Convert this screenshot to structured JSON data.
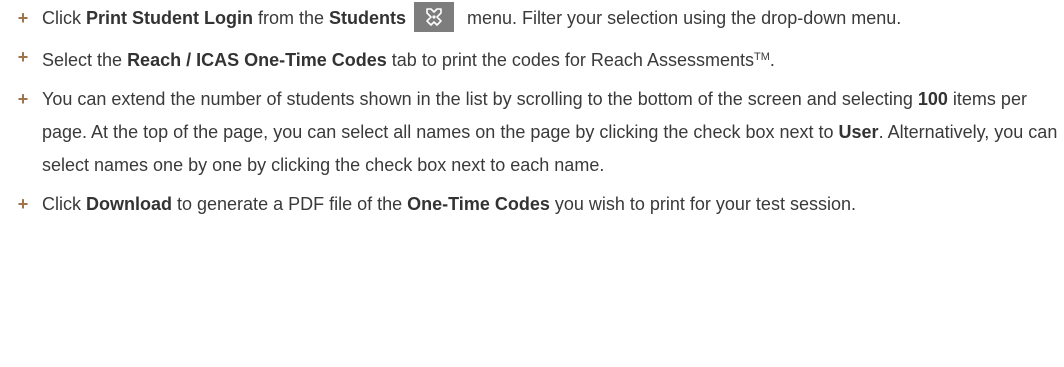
{
  "bullet_glyph": "+",
  "icon": "student-icon",
  "colors": {
    "bullet": "#a0744a",
    "icon_bg": "#7d7d7d",
    "text": "#3a3a3a"
  },
  "steps": [
    {
      "t1": "Click ",
      "b1": "Print Student Login",
      "t2": " from the ",
      "b2": "Students",
      "t3": " menu. Filter your selection using the drop-down menu."
    },
    {
      "t1": "Select the ",
      "b1": "Reach / ICAS One-Time Codes",
      "t2": " tab to print the codes for Reach Assessments",
      "tm": "TM",
      "t3": "."
    },
    {
      "t1": "You can extend the number of students shown in the list by scrolling to the bottom of the screen and selecting ",
      "b1": "100",
      "t2": " items per page. At the top of the page, you can select all names on the page by clicking the check box next to ",
      "b2": "User",
      "t3": ". Alternatively, you can select names one by one by clicking the check box next to each name."
    },
    {
      "t1": "Click ",
      "b1": "Download",
      "t2": " to generate a PDF file of the ",
      "b2": "One-Time Codes",
      "t3": " you wish to print for your test session."
    }
  ]
}
